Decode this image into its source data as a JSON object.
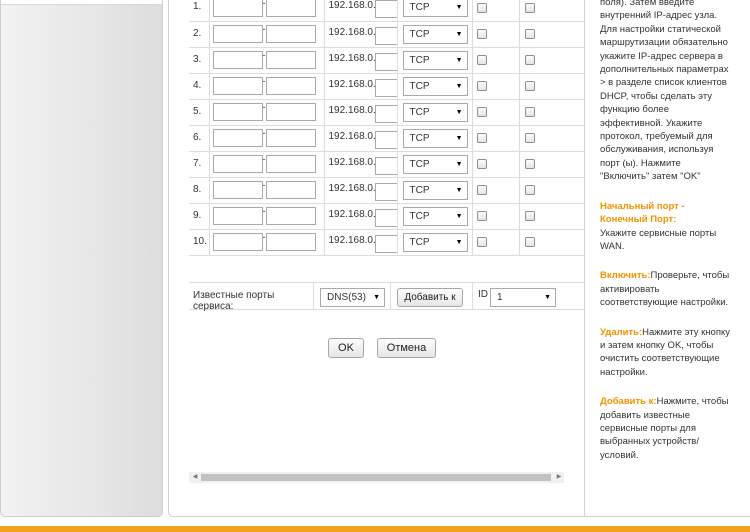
{
  "table": {
    "ip_prefix": "192.168.0.",
    "rows": [
      {
        "no": "1.",
        "protocol": "TCP"
      },
      {
        "no": "2.",
        "protocol": "TCP"
      },
      {
        "no": "3.",
        "protocol": "TCP"
      },
      {
        "no": "4.",
        "protocol": "TCP"
      },
      {
        "no": "5.",
        "protocol": "TCP"
      },
      {
        "no": "6.",
        "protocol": "TCP"
      },
      {
        "no": "7.",
        "protocol": "TCP"
      },
      {
        "no": "8.",
        "protocol": "TCP"
      },
      {
        "no": "9.",
        "protocol": "TCP"
      },
      {
        "no": "10.",
        "protocol": "TCP"
      }
    ]
  },
  "known_ports": {
    "label": "Известные порты сервиса:",
    "service_selected": "DNS(53)",
    "add_button": "Добавить к",
    "id_label": "ID",
    "id_selected": "1"
  },
  "actions": {
    "ok": "OK",
    "cancel": "Отмена"
  },
  "help": {
    "intro": "поля). Затем введите внутренний IP-адрес узла. Для настройки статической маршрутизации обязательно укажите IP-адрес сервера в дополнительных параметрах > в разделе список клиентов DHCP, чтобы сделать эту функцию более эффективной. Укажите протокол, требуемый для обслуживания, используя порт (ы). Нажмите \"Включить\" затем \"OK\"",
    "start_end_port_title": "Начальный порт - Конечный Порт:",
    "start_end_port_text": "Укажите сервисные порты WAN.",
    "enable_title": "Включить:",
    "enable_text": "Проверьте, чтобы активировать соответствующие настройки.",
    "delete_title": "Удалить:",
    "delete_text": "Нажмите эту кнопку и затем кнопку OK, чтобы очистить соответствующие настройки.",
    "add_to_title": "Добавить к:",
    "add_to_text": "Нажмите, чтобы добавить известные сервисные порты для выбранных устройств/ условий."
  },
  "icons": {
    "select_arrow": "chevron-down-icon",
    "scroll_left": "arrow-left-icon",
    "scroll_right": "arrow-right-icon"
  },
  "colors": {
    "accent": "#f39100",
    "footer": "#f3a21b",
    "border": "#dddddd"
  }
}
